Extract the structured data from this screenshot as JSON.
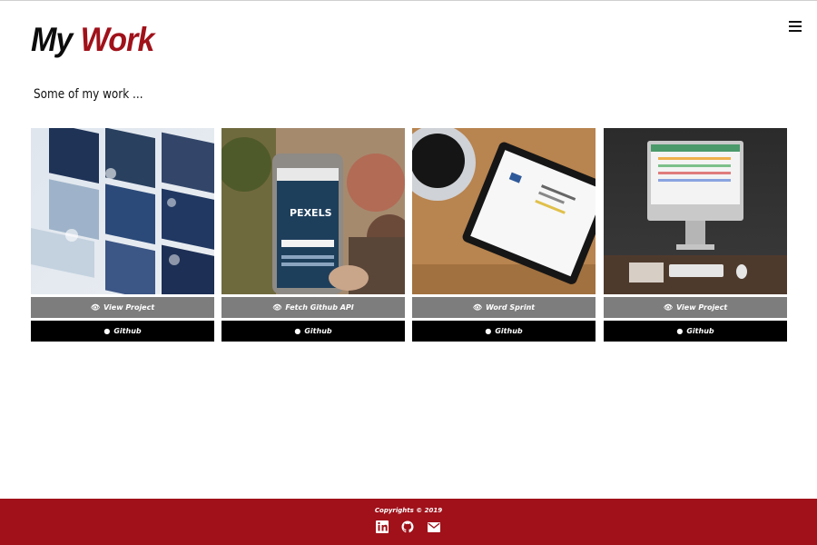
{
  "header": {
    "title_first": "My",
    "title_second": "Work",
    "menu_icon": "hamburger-menu-icon"
  },
  "intro": "Some of my work ...",
  "projects": [
    {
      "name": "View Project",
      "github": "Github",
      "image": "wall of video thumbnails"
    },
    {
      "name": "Fetch Github API",
      "github": "Github",
      "image": "phone showing pexels site"
    },
    {
      "name": "Word Sprint",
      "github": "Github",
      "image": "tablet and coffee cup"
    },
    {
      "name": "View Project",
      "github": "Github",
      "image": "desktop computer with calendar"
    }
  ],
  "footer": {
    "copyright": "Copyrights © 2019",
    "social": [
      "linkedin-icon",
      "github-icon",
      "envelope-icon"
    ]
  },
  "colors": {
    "accent": "#a0111a",
    "view_button": "#7d7d7d",
    "github_button": "#000000"
  }
}
